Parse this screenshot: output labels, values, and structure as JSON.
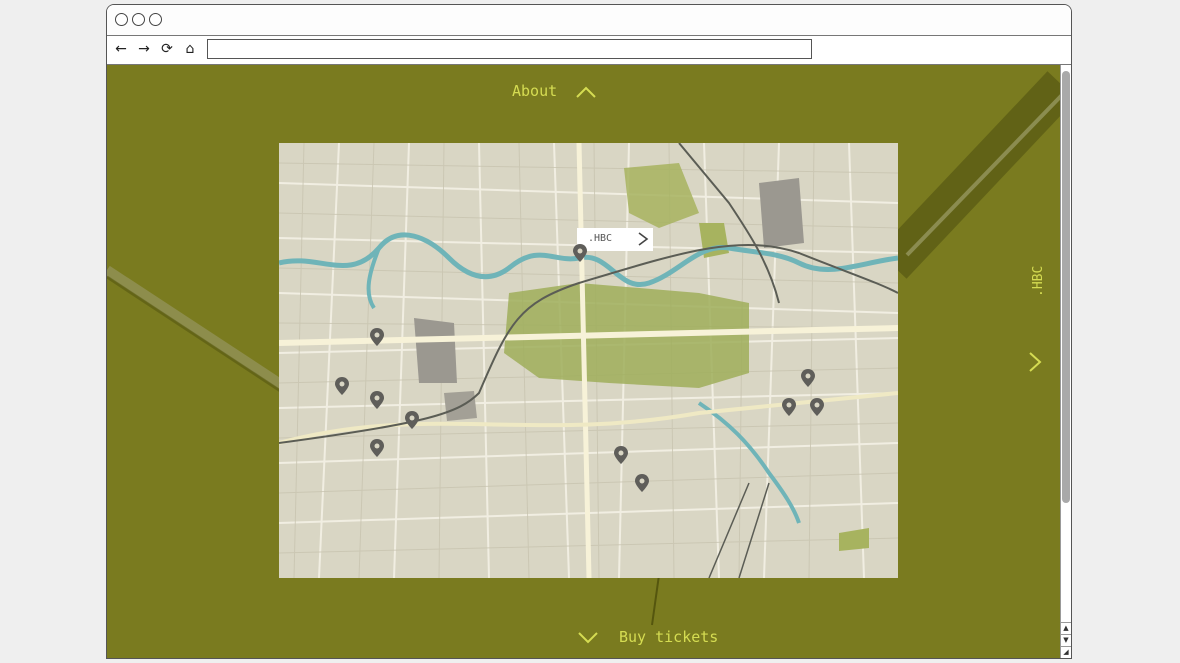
{
  "browser": {
    "url": "",
    "nav": {
      "back": "←",
      "forward": "→",
      "reload": "⟳",
      "home": "⌂"
    }
  },
  "page": {
    "about_label": "About",
    "buy_label": "Buy tickets",
    "side_label": ".HBC",
    "map_callout": ".HBC",
    "colors": {
      "background": "#7a7b1f",
      "accent": "#d5dc52"
    }
  },
  "icons": {
    "up": "chevron-up-icon",
    "down": "chevron-down-icon",
    "right": "chevron-right-icon",
    "pin": "map-pin-icon"
  }
}
